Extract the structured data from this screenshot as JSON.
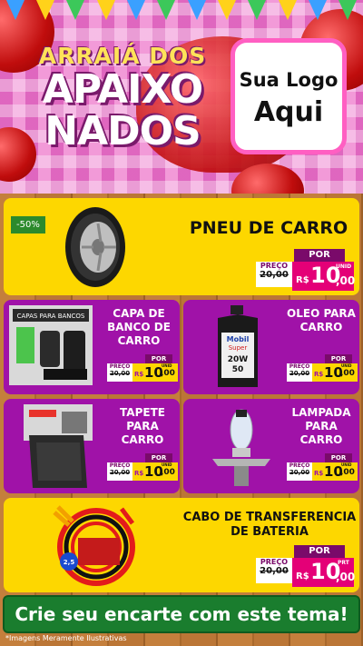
{
  "header": {
    "title_line1": "ARRAIÁ DOS",
    "title_line2": "APAIXO",
    "title_line3": "NADOS",
    "logo_line1": "Sua Logo",
    "logo_line2": "Aqui"
  },
  "products": [
    {
      "name": "PNEU DE CARRO",
      "badge": "-50%",
      "por": "POR",
      "preco_label": "PREÇO",
      "old_price": "20,00",
      "currency": "R$",
      "price_int": "10",
      "price_dec": ",00",
      "unit": "UNID",
      "icon": "tire-icon"
    },
    {
      "name": "CAPA DE BANCO DE CARRO",
      "por": "POR",
      "preco_label": "PREÇO",
      "old_price": "20,00",
      "currency": "R$",
      "price_int": "10",
      "price_dec": ",00",
      "unit": "UNID",
      "icon": "seat-cover-icon",
      "image_text": "CAPAS PARA BANCOS"
    },
    {
      "name": "OLEO PARA CARRO",
      "por": "POR",
      "preco_label": "PREÇO",
      "old_price": "20,00",
      "currency": "R$",
      "price_int": "10",
      "price_dec": ",00",
      "unit": "UNID",
      "icon": "oil-bottle-icon",
      "image_text": "Mobil Super 20W 50"
    },
    {
      "name": "TAPETE PARA CARRO",
      "por": "POR",
      "preco_label": "PREÇO",
      "old_price": "20,00",
      "currency": "R$",
      "price_int": "10",
      "price_dec": ",00",
      "unit": "UNID",
      "icon": "car-mat-icon"
    },
    {
      "name": "LAMPADA PARA CARRO",
      "por": "POR",
      "preco_label": "PREÇO",
      "old_price": "20,00",
      "currency": "R$",
      "price_int": "10",
      "price_dec": ",00",
      "unit": "UNID",
      "icon": "bulb-icon"
    },
    {
      "name": "CABO DE TRANSFERENCIA DE BATERIA",
      "por": "POR",
      "preco_label": "PREÇO",
      "old_price": "20,00",
      "currency": "R$",
      "price_int": "10",
      "price_dec": ",00",
      "unit": "PRT",
      "icon": "jumper-cable-icon",
      "image_text": "2,5"
    }
  ],
  "cta": "Crie seu encarte com este tema!",
  "disclaimer": "*Imagens Meramente Ilustrativas",
  "colors": {
    "purple": "#a012a8",
    "yellow": "#fdd700",
    "magenta": "#e40077",
    "green": "#1a7d2e"
  }
}
